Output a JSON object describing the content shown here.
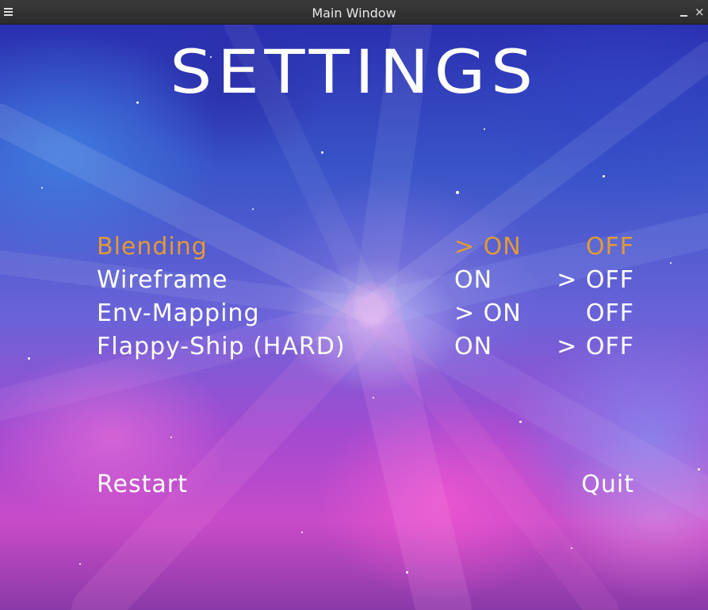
{
  "window": {
    "title": "Main Window",
    "menu_icon": "hamburger-menu-icon",
    "minimize_icon": "minimize-icon",
    "close_icon": "close-icon",
    "close_glyph": "×"
  },
  "settings": {
    "heading": "SETTINGS",
    "selected_color": "#e39a34",
    "text_color": "#ffffff",
    "options": [
      {
        "label": "Blending",
        "on": "> ON",
        "off": "OFF",
        "value": "ON",
        "focused": true
      },
      {
        "label": "Wireframe",
        "on": "ON",
        "off": "> OFF",
        "value": "OFF",
        "focused": false
      },
      {
        "label": "Env-Mapping",
        "on": "> ON",
        "off": "OFF",
        "value": "ON",
        "focused": false
      },
      {
        "label": "Flappy-Ship (HARD)",
        "on": "ON",
        "off": "> OFF",
        "value": "OFF",
        "focused": false
      }
    ],
    "restart_label": "Restart",
    "quit_label": "Quit"
  }
}
